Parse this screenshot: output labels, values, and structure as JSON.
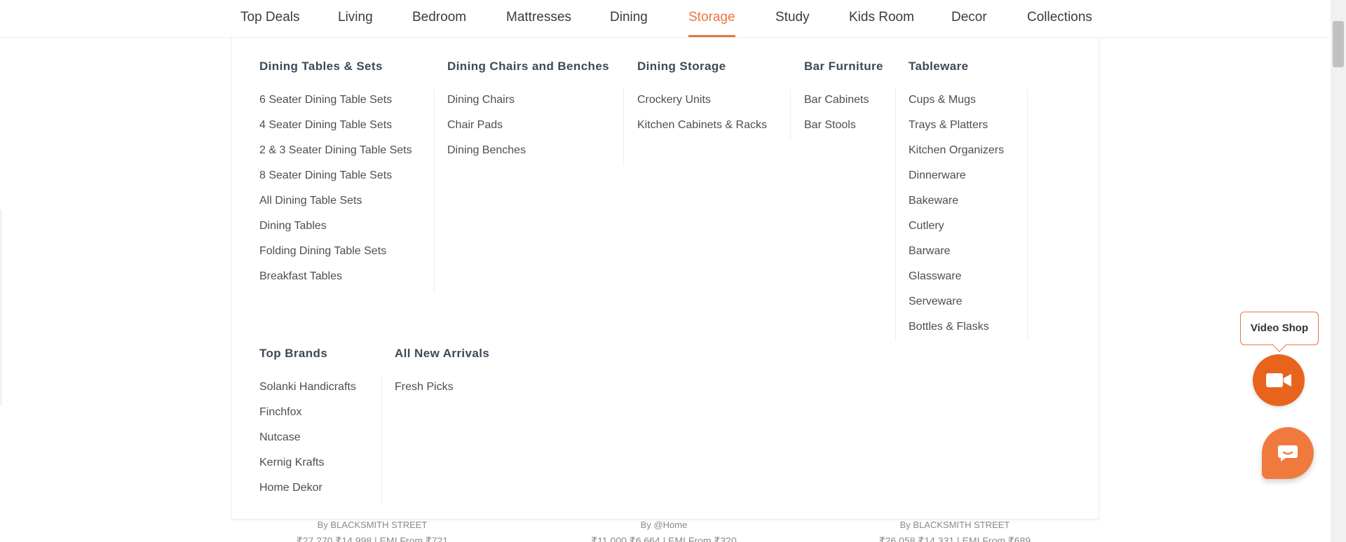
{
  "nav": {
    "items": [
      "Top Deals",
      "Living",
      "Bedroom",
      "Mattresses",
      "Dining",
      "Storage",
      "Study",
      "Kids Room",
      "Decor",
      "Collections"
    ],
    "active": "Storage",
    "accent_color": "#e8773f"
  },
  "menu": {
    "dining_tables": {
      "title": "Dining Tables & Sets",
      "items": [
        "6 Seater Dining Table Sets",
        "4 Seater Dining Table Sets",
        "2 & 3 Seater Dining Table Sets",
        "8 Seater Dining Table Sets",
        "All Dining Table Sets",
        "Dining Tables",
        "Folding Dining Table Sets",
        "Breakfast Tables"
      ]
    },
    "dining_chairs": {
      "title": "Dining Chairs and Benches",
      "items": [
        "Dining Chairs",
        "Chair Pads",
        "Dining Benches"
      ]
    },
    "dining_storage": {
      "title": "Dining Storage",
      "items": [
        "Crockery Units",
        "Kitchen Cabinets & Racks"
      ]
    },
    "bar_furniture": {
      "title": "Bar Furniture",
      "items": [
        "Bar Cabinets",
        "Bar Stools"
      ]
    },
    "tableware": {
      "title": "Tableware",
      "items": [
        "Cups & Mugs",
        "Trays & Platters",
        "Kitchen Organizers",
        "Dinnerware",
        "Bakeware",
        "Cutlery",
        "Barware",
        "Glassware",
        "Serveware",
        "Bottles & Flasks"
      ]
    },
    "top_brands": {
      "title": "Top Brands",
      "items": [
        "Solanki Handicrafts",
        "Finchfox",
        "Nutcase",
        "Kernig Krafts",
        "Home Dekor"
      ]
    },
    "new_arrivals": {
      "title": "All New Arrivals",
      "items": [
        "Fresh Picks"
      ]
    }
  },
  "products": [
    {
      "brand": "By BLACKSMITH STREET",
      "price": "₹27,270 ₹14,998 | EMI From ₹721"
    },
    {
      "brand": "By @Home",
      "price": "₹11,000 ₹6,664 | EMI From ₹320"
    },
    {
      "brand": "By BLACKSMITH STREET",
      "price": "₹26,058 ₹14,331 | EMI From ₹689"
    }
  ],
  "widgets": {
    "video_shop_label": "Video Shop",
    "video_icon": "video-camera-icon",
    "chat_icon": "chat-icon",
    "video_color": "#e8641c",
    "chat_color": "#f07a3e"
  }
}
